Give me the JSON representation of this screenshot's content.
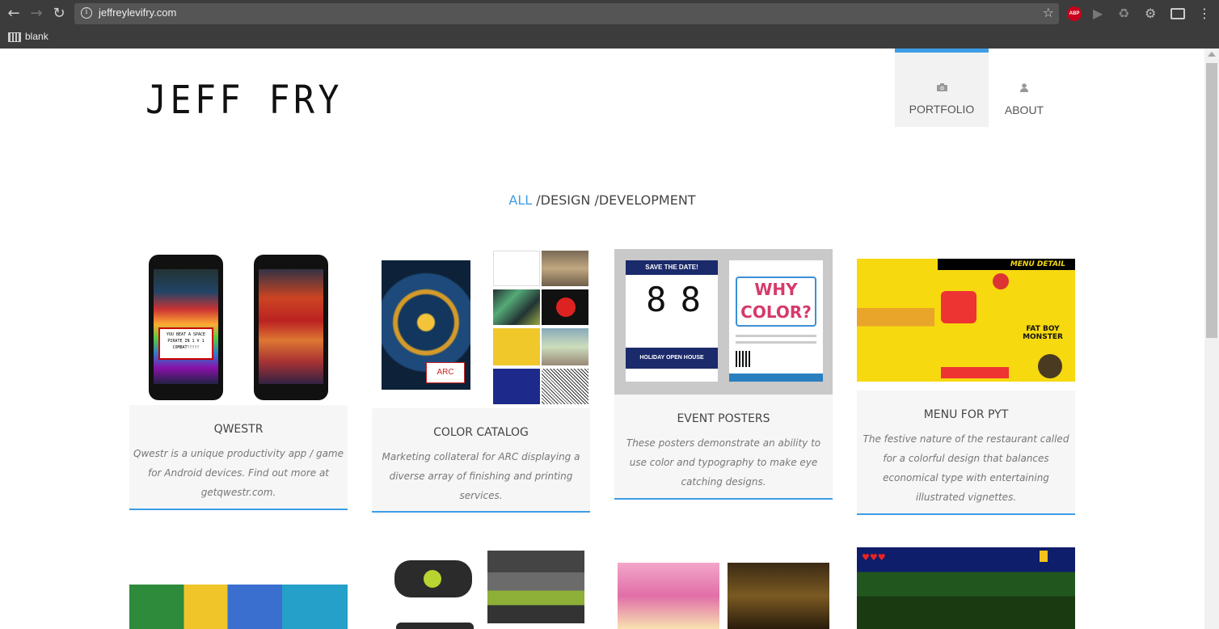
{
  "browser": {
    "url": "jeffreylevifry.com",
    "abp_label": "ABP",
    "bookmark_label": "blank"
  },
  "site": {
    "logo": "JEFF FRY",
    "nav": [
      {
        "label": "PORTFOLIO",
        "icon": "camera-icon",
        "active": true
      },
      {
        "label": "ABOUT",
        "icon": "user-icon",
        "active": false
      }
    ],
    "filters": [
      {
        "label": "ALL",
        "active": true
      },
      {
        "label": " /DESIGN",
        "active": false
      },
      {
        "label": " /DEVELOPMENT",
        "active": false
      }
    ]
  },
  "projects": [
    {
      "title": "QWESTR",
      "description": "Qwestr is a unique productivity app / game for Android devices. Find out more at getqwestr.com.",
      "popup_text": "YOU BEAT A SPACE PIRATE IN 1 V 1 COMBAT!!!!!"
    },
    {
      "title": "COLOR CATALOG",
      "description": "Marketing collateral for ARC displaying a diverse array of finishing and printing services."
    },
    {
      "title": "EVENT POSTERS",
      "description": "These posters demonstrate an ability to use color and typography to make eye catching designs.",
      "poster_banner": "SAVE THE DATE!",
      "poster_title": "WHY COLOR?",
      "poster_house": "HOLIDAY OPEN HOUSE"
    },
    {
      "title": "MENU FOR PYT",
      "description": "The festive nature of the restaurant called for a colorful design that balances economical type with entertaining illustrated vignettes.",
      "menu_header": "MENU DETAIL",
      "menu_item": "FAT BOY MONSTER"
    }
  ],
  "colors": {
    "accent": "#3d9de6",
    "card_bg": "#f6f6f6"
  }
}
